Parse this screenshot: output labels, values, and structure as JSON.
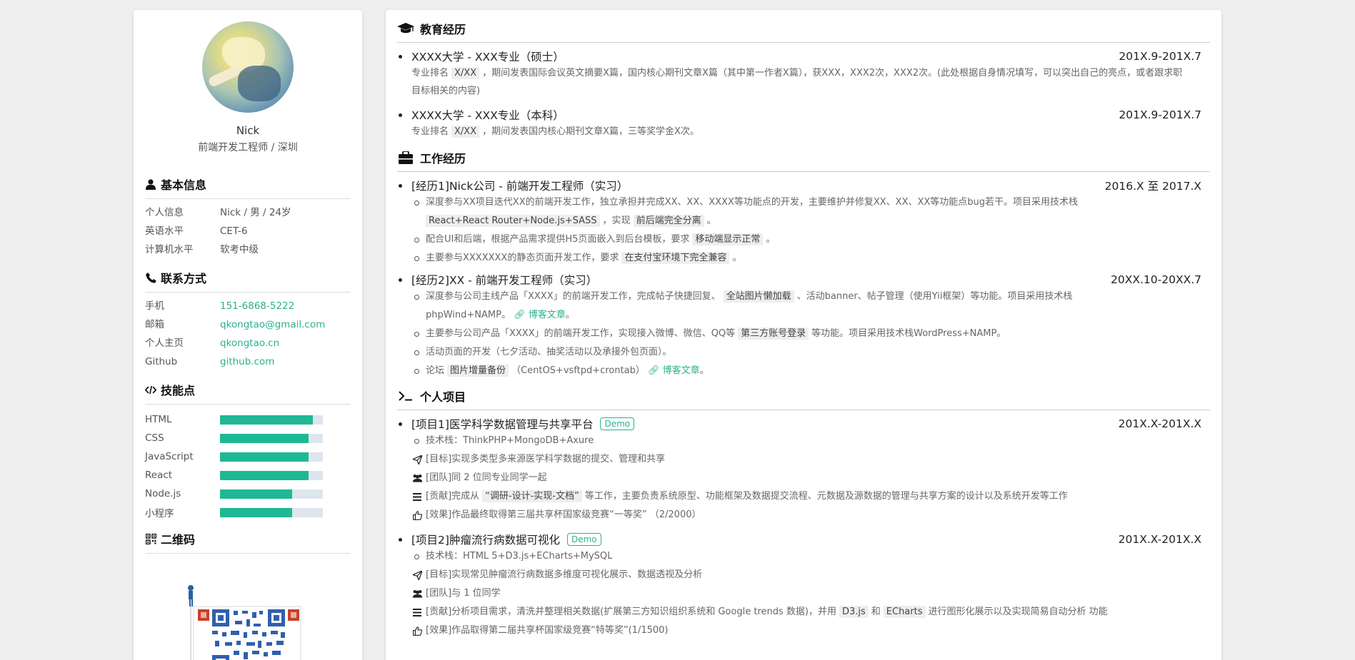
{
  "profile": {
    "name": "Nick",
    "title": "前端开发工程师 / 深圳"
  },
  "basic": {
    "heading": "基本信息",
    "rows": [
      {
        "k": "个人信息",
        "v": "Nick / 男 / 24岁"
      },
      {
        "k": "英语水平",
        "v": "CET-6"
      },
      {
        "k": "计算机水平",
        "v": "软考中级"
      }
    ]
  },
  "contact": {
    "heading": "联系方式",
    "rows": [
      {
        "k": "手机",
        "v": "151-6868-5222"
      },
      {
        "k": "邮箱",
        "v": "qkongtao@gmail.com"
      },
      {
        "k": "个人主页",
        "v": "qkongtao.cn"
      },
      {
        "k": "Github",
        "v": "github.com"
      }
    ]
  },
  "skills": {
    "heading": "技能点",
    "items": [
      {
        "k": "HTML",
        "level": 0.9
      },
      {
        "k": "CSS",
        "level": 0.86
      },
      {
        "k": "JavaScript",
        "level": 0.86
      },
      {
        "k": "React",
        "level": 0.86
      },
      {
        "k": "Node.js",
        "level": 0.7
      },
      {
        "k": "小程序",
        "level": 0.7
      }
    ]
  },
  "qr": {
    "heading": "二维码"
  },
  "education": {
    "heading": "教育经历",
    "items": [
      {
        "title": "XXXX大学 - XXX专业（硕士）",
        "date": "201X.9-201X.7",
        "pre": "专业排名",
        "hl": "X/XX",
        "post": "，期间发表国际会议英文摘要X篇，国内核心期刊文章X篇（其中第一作者X篇），获XXX，XXX2次，XXX2次。(此处根据自身情况填写，可以突出自己的亮点，或者跟求职目标相关的内容)"
      },
      {
        "title": "XXXX大学 - XXX专业（本科）",
        "date": "201X.9-201X.7",
        "pre": "专业排名",
        "hl": "X/XX",
        "post": "，期间发表国内核心期刊文章X篇，三等奖学金X次。"
      }
    ]
  },
  "work": {
    "heading": "工作经历",
    "job1": {
      "title": "[经历1]Nick公司 - 前端开发工程师（实习）",
      "date": "2016.X 至 2017.X",
      "l1a": "深度参与XX项目迭代XX的前端开发工作，独立承担并完成XX、XX、XXXX等功能点的开发，主要维护并修复XX、XX、XX等功能点bug若干。项目采用技术栈",
      "l1h1": "React+React Router+Node.js+SASS",
      "l1b": "，实现",
      "l1h2": "前后端完全分离",
      "l1c": "。",
      "l2a": "配合UI和后端，根据产品需求提供H5页面嵌入到后台模板，要求",
      "l2h": "移动端显示正常",
      "l2b": "。",
      "l3a": "主要参与XXXXXXX的静态页面开发工作，要求",
      "l3h": "在支付宝环境下完全兼容",
      "l3b": "。"
    },
    "job2": {
      "title": "[经历2]XX - 前端开发工程师（实习）",
      "date": "20XX.10-20XX.7",
      "l1a": "深度参与公司主线产品「XXXX」的前端开发工作，完成帖子快捷回复、",
      "l1h": "全站图片懒加载",
      "l1b": "、活动banner、帖子管理（使用Yii框架）等功能。项目采用技术栈phpWind+NAMP。",
      "l1link": "博客文章",
      "l1c": "。",
      "l2a": "主要参与公司产品「XXXX」的前端开发工作，实现接入微博、微信、QQ等",
      "l2h": "第三方账号登录",
      "l2b": "等功能。项目采用技术栈WordPress+NAMP。",
      "l3": "活动页面的开发（七夕活动、抽奖活动以及承接外包页面）。",
      "l4a": "论坛",
      "l4h": "图片增量备份",
      "l4b": "（CentOS+vsftpd+crontab）",
      "l4link": "博客文章",
      "l4c": "。"
    }
  },
  "projects": {
    "heading": "个人项目",
    "p1": {
      "title": "[项目1]医学科学数据管理与共享平台",
      "badge": "Demo",
      "date": "201X.X-201X.X",
      "stack": "技术栈：ThinkPHP+MongoDB+Axure",
      "goal": "[目标]实现多类型多来源医学科学数据的提交、管理和共享",
      "team": "[团队]同 2 位同专业同学一起",
      "contrib_a": "[贡献]完成从",
      "contrib_h": "“调研-设计-实现-文档”",
      "contrib_b": "等工作，主要负责系统原型、功能框架及数据提交流程、元数据及源数据的管理与共享方案的设计以及系统开发等工作",
      "effect": "[效果]作品最终取得第三届共享杯国家级竞赛“一等奖” （2/2000）"
    },
    "p2": {
      "title": "[项目2]肿瘤流行病数据可视化",
      "badge": "Demo",
      "date": "201X.X-201X.X",
      "stack": "技术栈：HTML 5+D3.js+ECharts+MySQL",
      "goal": "[目标]实现常见肿瘤流行病数据多维度可视化展示、数据透视及分析",
      "team": "[团队]与 1 位同学",
      "contrib_a": "[贡献]分析项目需求，清洗并整理相关数据(扩展第三方知识组织系统和 Google trends 数据)，并用",
      "contrib_h1": "D3.js",
      "contrib_m": "和",
      "contrib_h2": "ECharts",
      "contrib_b": "进行图形化展示以及实现简易自动分析 功能",
      "effect": "[效果]作品取得第二届共享杯国家级竞赛“特等奖”(1/1500)"
    }
  }
}
